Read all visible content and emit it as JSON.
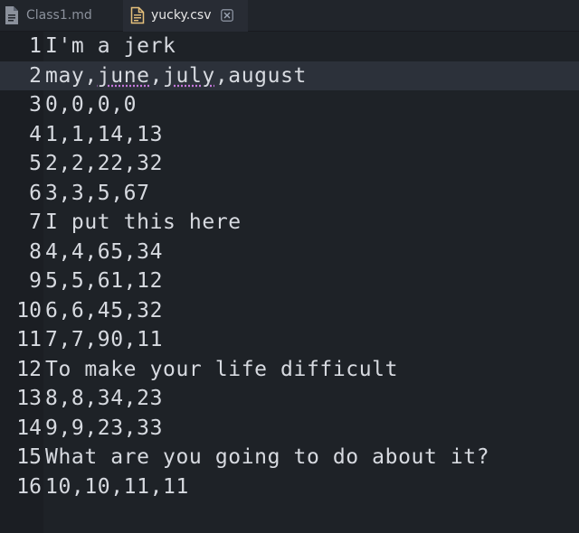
{
  "tabs": [
    {
      "label": "Class1.md",
      "icon": "file-icon",
      "active": false
    },
    {
      "label": "yucky.csv",
      "icon": "file-text-icon",
      "active": true,
      "close_icon": "close-icon"
    }
  ],
  "editor": {
    "current_line": 2,
    "lines": [
      {
        "n": "1",
        "text": "I'm a jerk"
      },
      {
        "n": "2",
        "text": "may,june,july,august"
      },
      {
        "n": "3",
        "text": "0,0,0,0"
      },
      {
        "n": "4",
        "text": "1,1,14,13"
      },
      {
        "n": "5",
        "text": "2,2,22,32"
      },
      {
        "n": "6",
        "text": "3,3,5,67"
      },
      {
        "n": "7",
        "text": "I put this here"
      },
      {
        "n": "8",
        "text": "4,4,65,34"
      },
      {
        "n": "9",
        "text": "5,5,61,12"
      },
      {
        "n": "10",
        "text": "6,6,45,32"
      },
      {
        "n": "11",
        "text": "7,7,90,11"
      },
      {
        "n": "12",
        "text": "To make your life difficult"
      },
      {
        "n": "13",
        "text": "8,8,34,23"
      },
      {
        "n": "14",
        "text": "9,9,23,33"
      },
      {
        "n": "15",
        "text": "What are you going to do about it?"
      },
      {
        "n": "16",
        "text": "10,10,11,11"
      }
    ],
    "line2_parts": {
      "a": "may,",
      "b": "june",
      "c": ",",
      "d": "july",
      "e": ",august"
    }
  },
  "colors": {
    "accent": "#e5c07b",
    "squiggle": "#c678dd"
  }
}
